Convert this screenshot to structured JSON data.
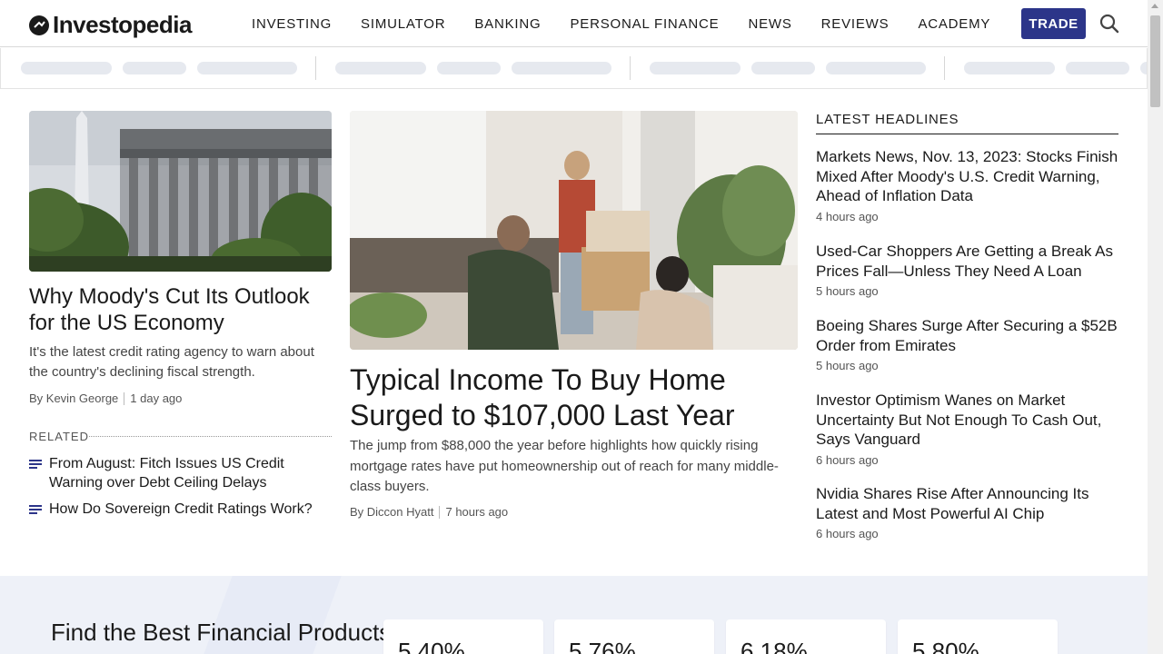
{
  "header": {
    "logo_text": "Investopedia",
    "nav": [
      "INVESTING",
      "SIMULATOR",
      "BANKING",
      "PERSONAL FINANCE",
      "NEWS",
      "REVIEWS",
      "ACADEMY"
    ],
    "trade_label": "TRADE",
    "brand_color": "#2c3589"
  },
  "left_story": {
    "title": "Why Moody's Cut Its Outlook for the US Economy",
    "description": "It's the latest credit rating agency to warn about the country's declining fiscal strength.",
    "author": "By Kevin George",
    "time": "1 day ago",
    "related_label": "RELATED",
    "related": [
      "From August: Fitch Issues US Credit Warning over Debt Ceiling Delays",
      "How Do Sovereign Credit Ratings Work?"
    ]
  },
  "center_story": {
    "title": "Typical Income To Buy Home Surged to $107,000 Last Year",
    "description": "The jump from $88,000 the year before highlights how quickly rising mortgage rates have put homeownership out of reach for many middle-class buyers.",
    "author": "By Diccon Hyatt",
    "time": "7 hours ago"
  },
  "latest": {
    "title": "LATEST HEADLINES",
    "items": [
      {
        "headline": "Markets News, Nov. 13, 2023: Stocks Finish Mixed After Moody's U.S. Credit Warning, Ahead of Inflation Data",
        "time": "4 hours ago"
      },
      {
        "headline": "Used-Car Shoppers Are Getting a Break As Prices Fall—Unless They Need A Loan",
        "time": "5 hours ago"
      },
      {
        "headline": "Boeing Shares Surge After Securing a $52B Order from Emirates",
        "time": "5 hours ago"
      },
      {
        "headline": "Investor Optimism Wanes on Market Uncertainty But Not Enough To Cash Out, Says Vanguard",
        "time": "6 hours ago"
      },
      {
        "headline": "Nvidia Shares Rise After Announcing Its Latest and Most Powerful AI Chip",
        "time": "6 hours ago"
      }
    ]
  },
  "products": {
    "title": "Find the Best Financial Products",
    "rates": [
      "5.40%",
      "5.76%",
      "6.18%",
      "5.80%"
    ]
  }
}
